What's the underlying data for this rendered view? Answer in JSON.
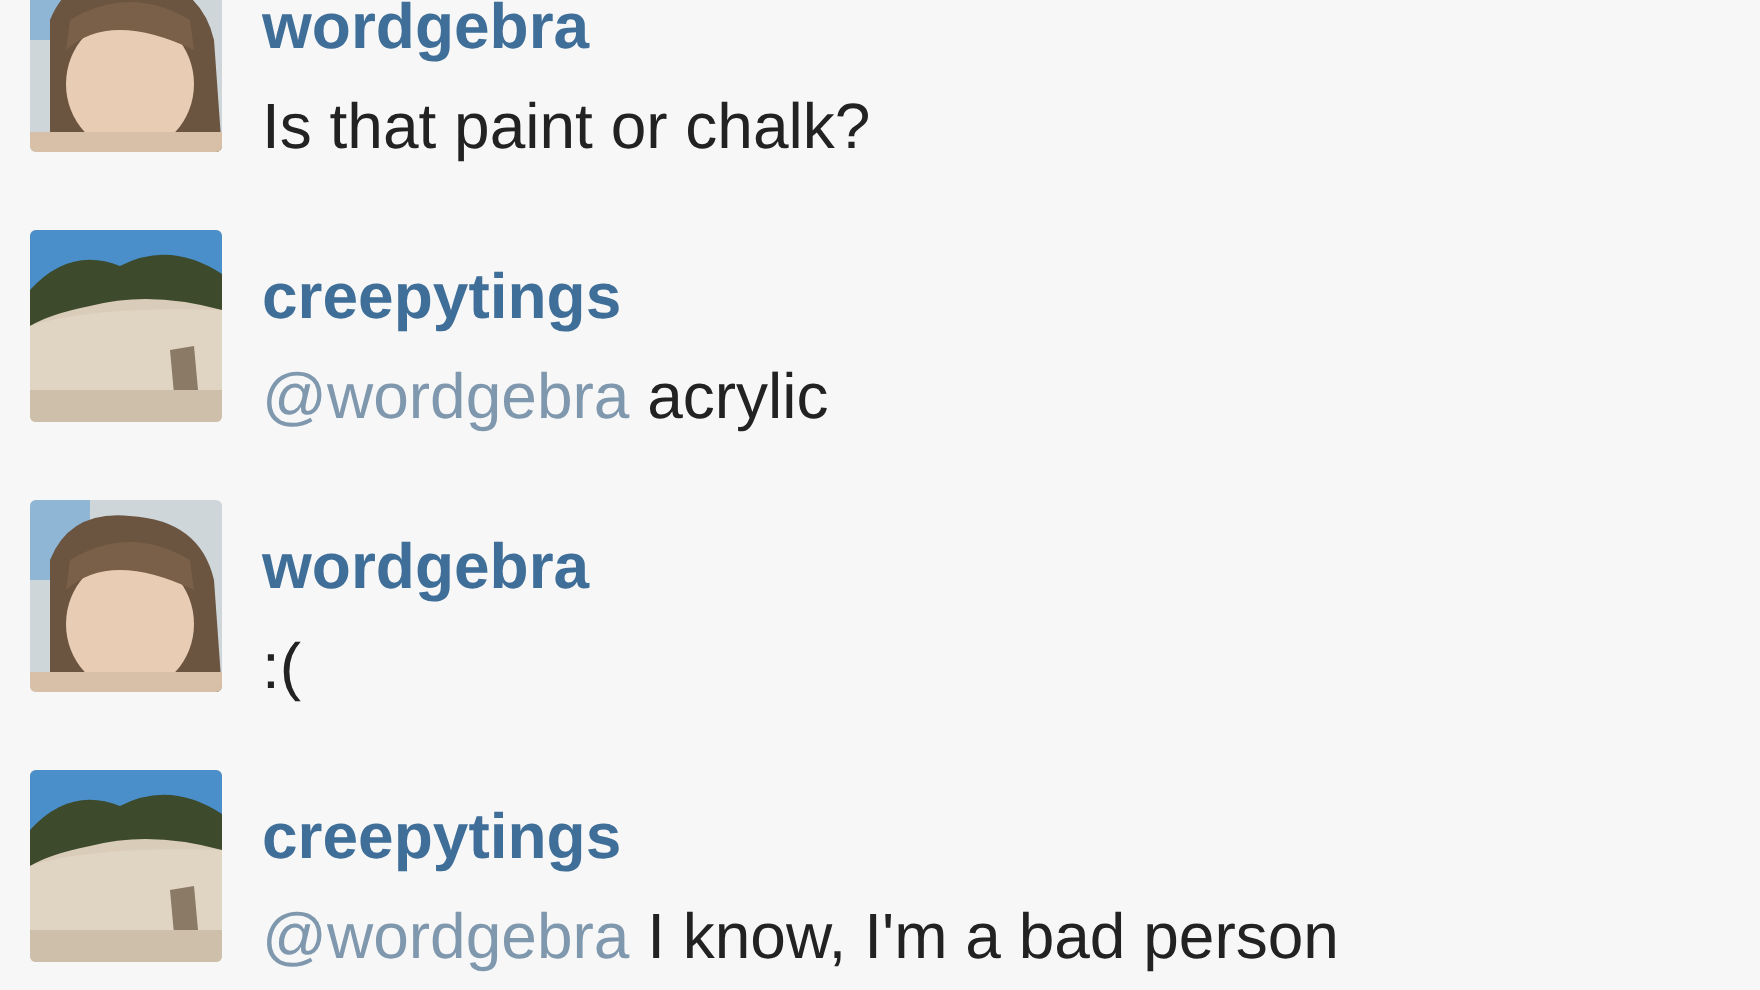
{
  "comments": [
    {
      "username": "wordgebra",
      "text": "Is that paint or chalk?"
    },
    {
      "username": "creepytings",
      "mention": "@wordgebra",
      "text": "acrylic"
    },
    {
      "username": "wordgebra",
      "text": ":("
    },
    {
      "username": "creepytings",
      "mention": "@wordgebra",
      "text": "I know, I'm a bad person"
    }
  ]
}
